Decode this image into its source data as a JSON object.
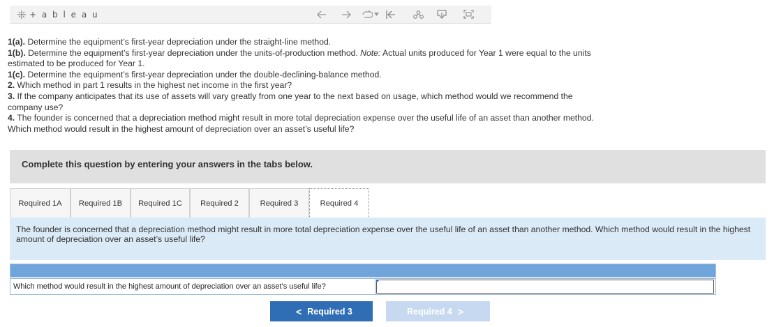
{
  "toolbar": {
    "logo_text": "+ a b l e a u",
    "icons": [
      "tableau-logo-icon",
      "back-arrow-icon",
      "forward-arrow-icon",
      "revert-icon",
      "dropdown-caret-icon",
      "reset-to-start-icon",
      "share-icon",
      "download-icon",
      "fullscreen-icon"
    ]
  },
  "questions": {
    "q1a_label": "1(a).",
    "q1a_text": " Determine the equipment’s first-year depreciation under the straight-line method.",
    "q1b_label": "1(b).",
    "q1b_text": " Determine the equipment’s first-year depreciation under the units-of-production method. ",
    "q1b_note": "Note:",
    "q1b_note_text": " Actual units produced for Year 1 were equal to the units estimated to be produced for Year 1.",
    "q1c_label": "1(c).",
    "q1c_text": " Determine the equipment’s first-year depreciation under the double-declining-balance method.",
    "q2_label": "2.",
    "q2_text": " Which method in part 1 results in the highest net income in the first year?",
    "q3_label": "3.",
    "q3_text": " If the company anticipates that its use of assets will vary greatly from one year to the next based on usage, which method would we recommend the company use?",
    "q4_label": "4.",
    "q4_text": " The founder is concerned that a depreciation method might result in more total depreciation expense over the useful life of an asset than another method. Which method would result in the highest amount of depreciation over an asset’s useful life?"
  },
  "instruction": "Complete this question by entering your answers in the tabs below.",
  "tabs": [
    {
      "label": "Required 1A",
      "active": false
    },
    {
      "label": "Required 1B",
      "active": false
    },
    {
      "label": "Required 1C",
      "active": false
    },
    {
      "label": "Required 2",
      "active": false
    },
    {
      "label": "Required 3",
      "active": false
    },
    {
      "label": "Required 4",
      "active": true
    }
  ],
  "tab_content": "The founder is concerned that a depreciation method might result in more total depreciation expense over the useful life of an asset than another method. Which method would result in the highest amount of depreciation over an asset’s useful life?",
  "answer_table": {
    "question": "Which method would result in the highest amount of depreciation over an asset's useful life?",
    "answer_value": ""
  },
  "nav": {
    "prev_label": "Required 3",
    "next_label": "Required 4",
    "prev_chevron": "<",
    "next_chevron": ">"
  },
  "colors": {
    "instruction_bg": "#e0e0e0",
    "content_bg": "#daeaf6",
    "table_header": "#70a5dc",
    "prev_button": "#2f6db5",
    "next_button_disabled": "#c7d9f0"
  }
}
